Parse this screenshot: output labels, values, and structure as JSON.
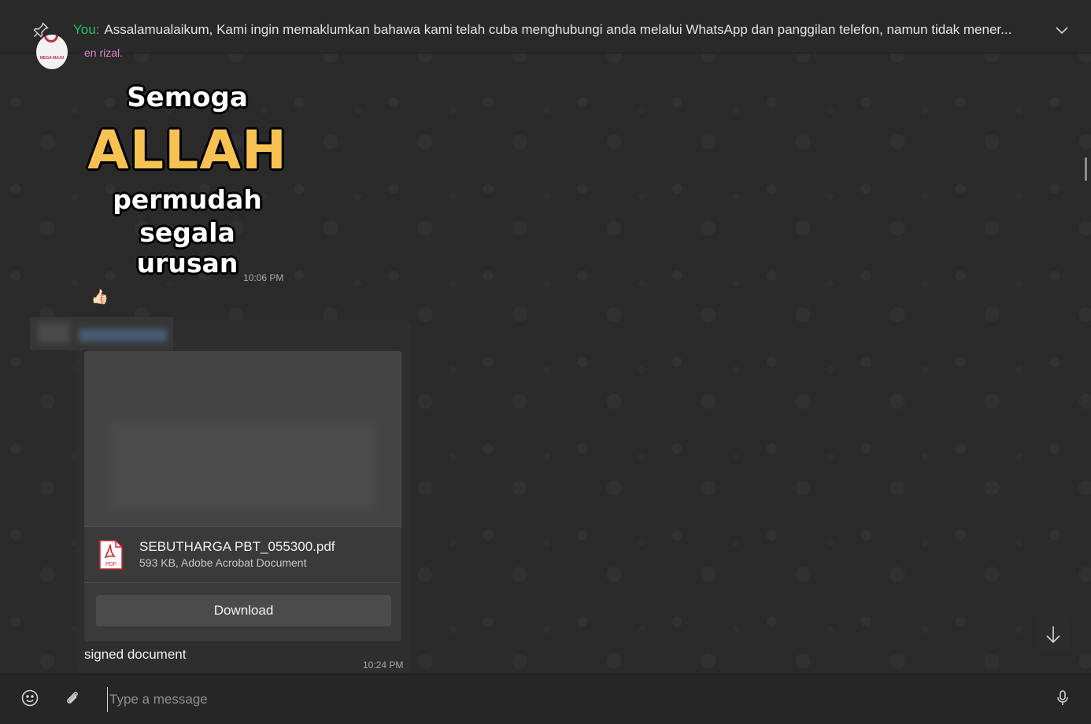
{
  "pinned": {
    "sender": "You:",
    "text": "Assalamualaikum,  Kami ingin memaklumkan bahawa kami telah cuba menghubungi anda melalui WhatsApp dan panggilan telefon, namun tidak mener..."
  },
  "avatar": {
    "text": "MEGA MAJU"
  },
  "message1": {
    "sender": "en rizal.",
    "sticker": {
      "line1": "Semoga",
      "line2": "ALLAH",
      "line3": "permudah",
      "line4": "segala urusan"
    },
    "time": "10:06 PM",
    "reaction": "👍🏻"
  },
  "message2": {
    "document": {
      "name": "SEBUTHARGA PBT_055300.pdf",
      "meta": "593 KB, Adobe Acrobat Document",
      "icon_label": "PDF",
      "download_label": "Download"
    },
    "caption": "signed document",
    "time": "10:24 PM"
  },
  "composer": {
    "placeholder": "Type a message"
  },
  "icons": {
    "pin": "pin-icon",
    "chevron": "chevron-down-icon",
    "emoji": "emoji-icon",
    "attach": "paperclip-icon",
    "mic": "microphone-icon",
    "scroll": "arrow-down-icon",
    "pdf": "pdf-icon"
  },
  "colors": {
    "accent_sender": "#21c063",
    "group_sender": "#d886c5",
    "pdf_red": "#d6242c",
    "sticker_gold": "#f6c251"
  }
}
